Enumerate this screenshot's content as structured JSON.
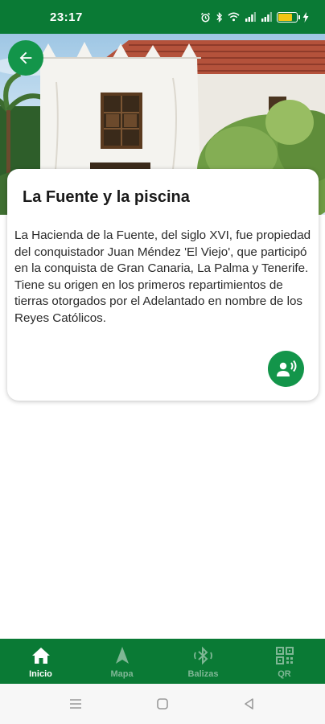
{
  "status_bar": {
    "time": "23:17",
    "battery_level": 0.7,
    "battery_color": "#f3c613"
  },
  "colors": {
    "primary": "#0a7a35",
    "button": "#13954a",
    "nav_inactive": "#7fb795"
  },
  "hero": {
    "icon": "hacienda-photo"
  },
  "back_button": {
    "icon": "arrow-left-icon"
  },
  "card": {
    "title": "La Fuente y la piscina",
    "text": "La Hacienda de la Fuente, del siglo XVI, fue propiedad del conquistador Juan Méndez 'El Viejo', que participó en la conquista de Gran Canaria, La Palma y Tenerife. Tiene su origen en los primeros repartimientos de tierras otorgados por el Adelantado en nombre de los Reyes Católicos.",
    "audio_icon": "voice-speaker-icon"
  },
  "bottom_nav": {
    "items": [
      {
        "label": "Inicio",
        "icon": "home-icon",
        "active": true
      },
      {
        "label": "Mapa",
        "icon": "navigation-arrow-icon",
        "active": false
      },
      {
        "label": "Balizas",
        "icon": "bluetooth-icon",
        "active": false
      },
      {
        "label": "QR",
        "icon": "qr-code-icon",
        "active": false
      }
    ]
  },
  "system_nav": {
    "items": [
      "menu-icon",
      "home-square-icon",
      "back-triangle-icon"
    ]
  }
}
